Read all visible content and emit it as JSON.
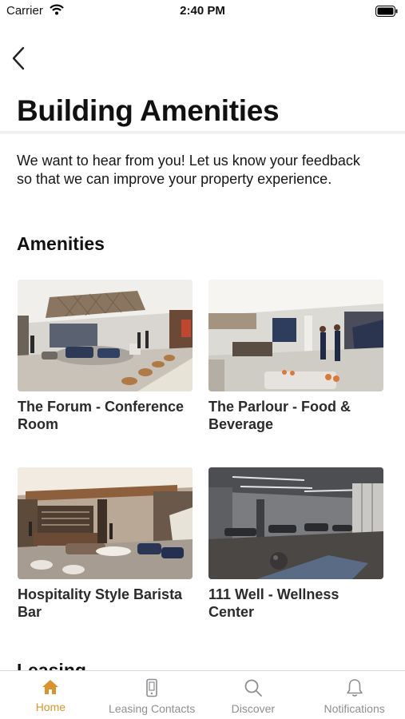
{
  "status_bar": {
    "carrier": "Carrier",
    "time": "2:40 PM"
  },
  "header": {
    "title": "Building Amenities"
  },
  "intro": "We want to hear from you! Let us know your feedback so that we can improve your property experience.",
  "sections": {
    "amenities": "Amenities",
    "leasing": "Leasing"
  },
  "amenities": [
    {
      "label": "The Forum - Conference Room"
    },
    {
      "label": "The Parlour - Food & Beverage"
    },
    {
      "label": "Hospitality Style Barista Bar"
    },
    {
      "label": "111 Well - Wellness Center"
    }
  ],
  "tabs": [
    {
      "label": "Home",
      "icon": "home-icon",
      "active": true
    },
    {
      "label": "Leasing Contacts",
      "icon": "phone-icon",
      "active": false
    },
    {
      "label": "Discover",
      "icon": "search-icon",
      "active": false
    },
    {
      "label": "Notifications",
      "icon": "bell-icon",
      "active": false
    }
  ],
  "colors": {
    "accent": "#d9952d",
    "inactive": "#8e8e93"
  }
}
